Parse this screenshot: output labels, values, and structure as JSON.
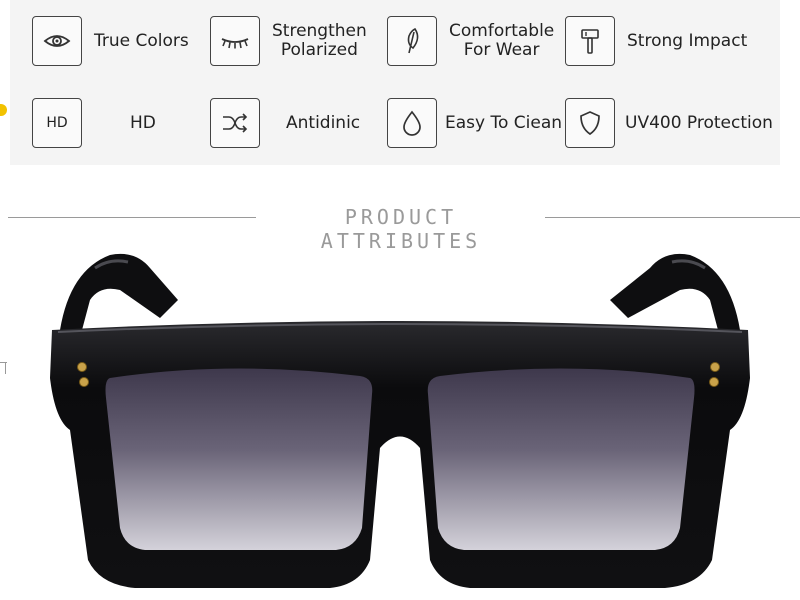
{
  "features": {
    "row1": [
      {
        "icon": "eye-icon",
        "label": "True Colors"
      },
      {
        "icon": "eyelash-icon",
        "label_line1": "Strengthen",
        "label_line2": "Polarized"
      },
      {
        "icon": "feather-icon",
        "label_line1": "Comfortable",
        "label_line2": "For Wear"
      },
      {
        "icon": "hammer-icon",
        "label": "Strong Impact"
      }
    ],
    "row2": [
      {
        "icon": "hd-icon",
        "icon_text": "HD",
        "label": "HD"
      },
      {
        "icon": "shuffle-icon",
        "label": "Antidinic"
      },
      {
        "icon": "water-drop-icon",
        "label": "Easy To Ciean"
      },
      {
        "icon": "shield-icon",
        "label": "UV400 Protection"
      }
    ]
  },
  "section_title": "PRODUCT ATTRIBUTES",
  "colors": {
    "feature_panel_bg": "#f4f4f4",
    "frame": "#0c0c0e",
    "lens_top": "#4a4458",
    "lens_bottom": "#cfcdd6",
    "rivets": "#c9a24a",
    "accent_dot": "#f2c200",
    "divider": "#9a9a9a"
  }
}
